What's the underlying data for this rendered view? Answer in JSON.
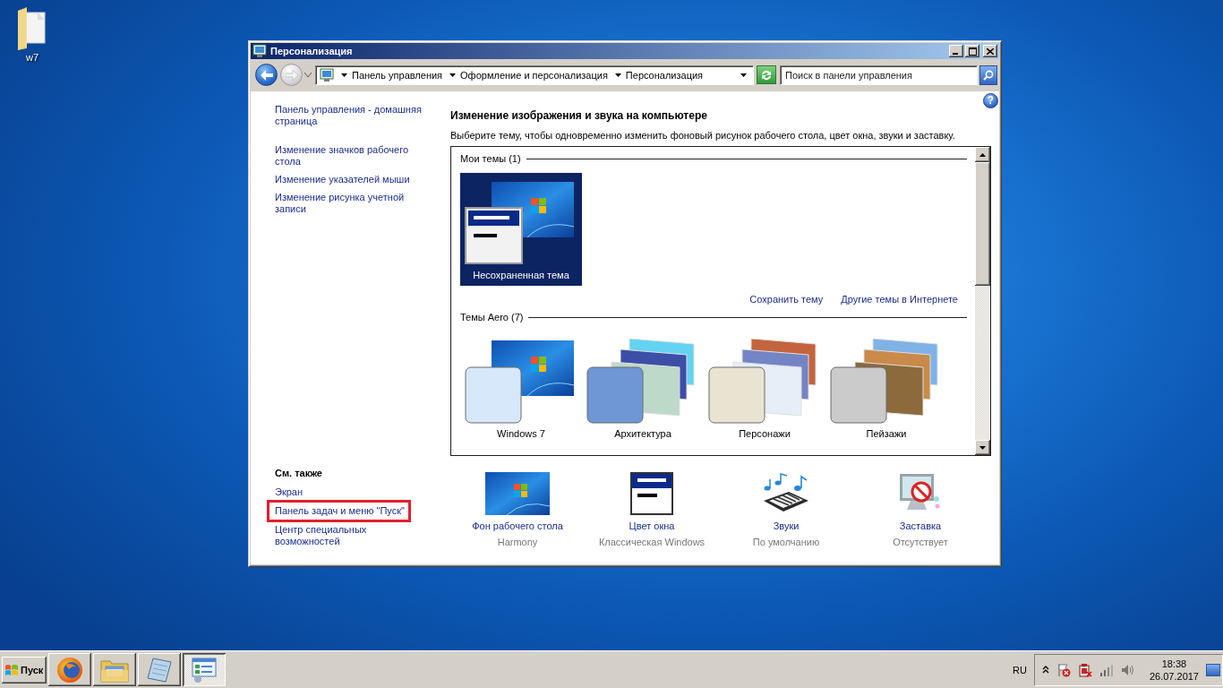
{
  "desktop": {
    "icons": [
      {
        "label": "w7"
      }
    ]
  },
  "window": {
    "title": "Персонализация",
    "breadcrumbs": [
      "Панель управления",
      "Оформление и персонализация",
      "Персонализация"
    ],
    "search": {
      "placeholder": "Поиск в панели управления"
    }
  },
  "sidebar": {
    "links": [
      "Панель управления - домашняя страница",
      "Изменение значков рабочего стола",
      "Изменение указателей мыши",
      "Изменение рисунка учетной записи"
    ],
    "see_also": {
      "title": "См. также",
      "items": [
        {
          "label": "Экран",
          "highlighted": false
        },
        {
          "label": "Панель задач и меню \"Пуск\"",
          "highlighted": true
        },
        {
          "label": "Центр специальных возможностей",
          "highlighted": false
        }
      ]
    }
  },
  "main": {
    "help": "?",
    "heading": "Изменение изображения и звука на компьютере",
    "description": "Выберите тему, чтобы одновременно изменить фоновый рисунок рабочего стола, цвет окна, звуки и заставку.",
    "theme_groups": [
      {
        "title": "Мои темы (1)",
        "themes": [
          {
            "name": "Несохраненная тема",
            "kind": "custom",
            "selected": true
          }
        ],
        "links": [
          "Сохранить тему",
          "Другие темы в Интернете"
        ]
      },
      {
        "title": "Темы Aero (7)",
        "themes": [
          {
            "name": "Windows 7",
            "kind": "single",
            "selected": false,
            "color": "#d6e8fa"
          },
          {
            "name": "Архитектура",
            "kind": "stack",
            "selected": false,
            "color": "#6f97d6"
          },
          {
            "name": "Персонажи",
            "kind": "stack",
            "selected": false,
            "color": "#e9e3d2"
          },
          {
            "name": "Пейзажи",
            "kind": "stack",
            "selected": false,
            "color": "#cbcbcb"
          }
        ]
      }
    ],
    "settings": [
      {
        "kind": "wallpaper",
        "label": "Фон рабочего стола",
        "value": "Harmony"
      },
      {
        "kind": "window_color",
        "label": "Цвет окна",
        "value": "Классическая Windows"
      },
      {
        "kind": "sounds",
        "label": "Звуки",
        "value": "По умолчанию"
      },
      {
        "kind": "screensaver",
        "label": "Заставка",
        "value": "Отсутствует"
      }
    ]
  },
  "taskbar": {
    "start": "Пуск",
    "apps": [
      {
        "kind": "browser",
        "selected": false
      },
      {
        "kind": "folder",
        "selected": false
      },
      {
        "kind": "notepad",
        "selected": false
      },
      {
        "kind": "control_panel",
        "selected": true
      }
    ],
    "language": "RU",
    "time": "18:38",
    "date": "26.07.2017"
  }
}
